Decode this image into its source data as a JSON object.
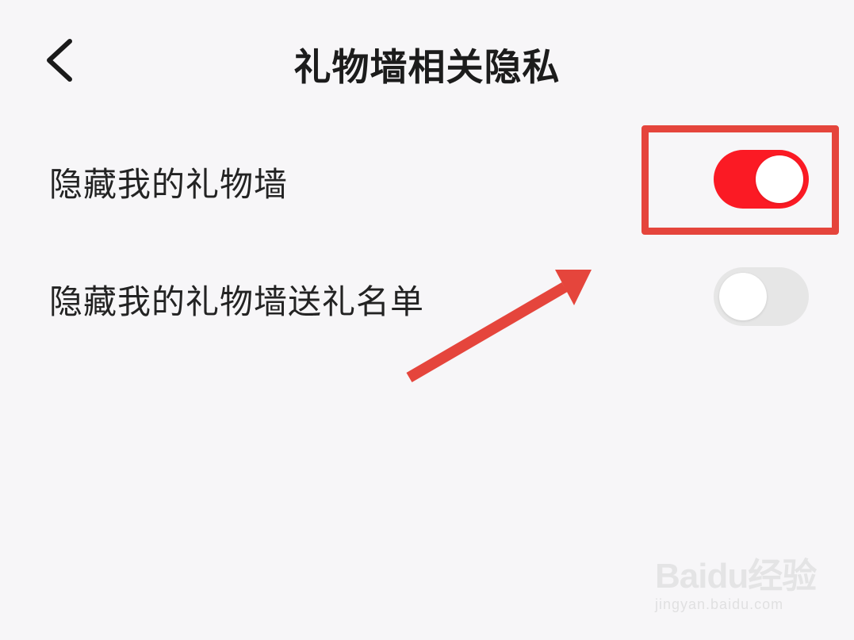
{
  "header": {
    "title": "礼物墙相关隐私",
    "back_icon": "chevron-left-icon"
  },
  "settings": [
    {
      "label": "隐藏我的礼物墙",
      "toggle_on": true
    },
    {
      "label": "隐藏我的礼物墙送礼名单",
      "toggle_on": false
    }
  ],
  "colors": {
    "toggle_on": "#fb1a24",
    "toggle_off": "#e6e6e6",
    "annotation": "#e5453c",
    "background": "#f7f6f8"
  },
  "watermark": {
    "logo": "Baidu经验",
    "url": "jingyan.baidu.com"
  }
}
